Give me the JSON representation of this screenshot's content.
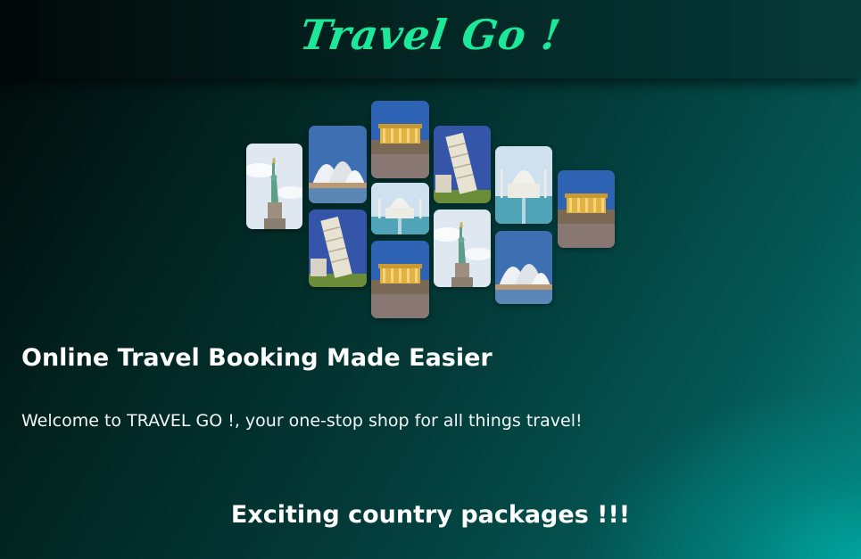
{
  "header": {
    "brand": "Travel Go !"
  },
  "collage": {
    "tiles": [
      {
        "subject": "statue-of-liberty"
      },
      {
        "subject": "sydney-opera-house"
      },
      {
        "subject": "leaning-tower-of-pisa"
      },
      {
        "subject": "parthenon"
      },
      {
        "subject": "taj-mahal"
      },
      {
        "subject": "parthenon"
      },
      {
        "subject": "leaning-tower-of-pisa"
      },
      {
        "subject": "statue-of-liberty"
      },
      {
        "subject": "taj-mahal"
      },
      {
        "subject": "sydney-opera-house"
      },
      {
        "subject": "parthenon"
      }
    ]
  },
  "hero": {
    "title": "Online Travel Booking Made Easier",
    "welcome": "Welcome to TRAVEL GO !, your one-stop shop for all things travel!"
  },
  "sections": {
    "packages_heading": "Exciting country packages !!!"
  },
  "colors": {
    "brand": "#1ce89a",
    "accent_teal": "#00a8a0",
    "background_dark": "#010909"
  }
}
